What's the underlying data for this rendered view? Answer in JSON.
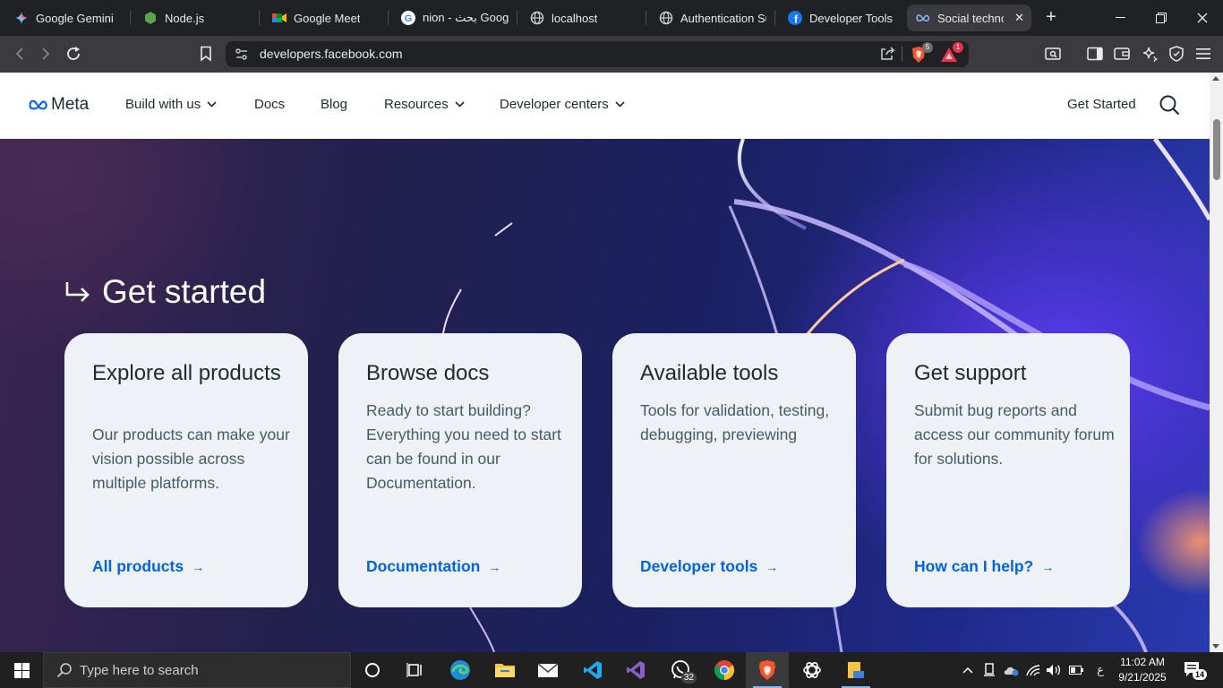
{
  "browser": {
    "tabs": [
      {
        "title": "Google Gemini",
        "icon": "gemini-icon"
      },
      {
        "title": "Node.js",
        "icon": "nodejs-icon"
      },
      {
        "title": "Google Meet",
        "icon": "google-meet-icon"
      },
      {
        "title": "nion - بحث Googl",
        "icon": "google-icon"
      },
      {
        "title": "localhost",
        "icon": "globe-icon"
      },
      {
        "title": "Authentication Su",
        "icon": "globe-icon"
      },
      {
        "title": "Developer Tools -",
        "icon": "facebook-icon"
      },
      {
        "title": "Social techno",
        "icon": "meta-icon",
        "active": true
      }
    ],
    "new_tab": "+",
    "url": "developers.facebook.com",
    "brave_shields_count": "5",
    "brave_rewards_count": "1"
  },
  "site": {
    "logo_text": "Meta",
    "nav": [
      {
        "label": "Build with us",
        "dropdown": true
      },
      {
        "label": "Docs",
        "dropdown": false
      },
      {
        "label": "Blog",
        "dropdown": false
      },
      {
        "label": "Resources",
        "dropdown": true
      },
      {
        "label": "Developer centers",
        "dropdown": true
      }
    ],
    "cta": "Get Started"
  },
  "hero": {
    "title": "Get started",
    "cards": [
      {
        "title": "Explore all products",
        "body": "Our products can make your vision possible across multiple platforms.",
        "link": "All products"
      },
      {
        "title": "Browse docs",
        "body": "Ready to start building? Everything you need to start can be found in our Documentation.",
        "link": "Documentation"
      },
      {
        "title": "Available tools",
        "body": "Tools for validation, testing, debugging, previewing",
        "link": "Developer tools"
      },
      {
        "title": "Get support",
        "body": "Submit bug reports and access our community forum for solutions.",
        "link": "How can I help?"
      }
    ]
  },
  "taskbar": {
    "search_placeholder": "Type here to search",
    "whatsapp_count": "32",
    "time": "11:02 AM",
    "date": "9/21/2025",
    "notifications": "14",
    "lang": "ع"
  },
  "colors": {
    "link": "#0064e0",
    "card_bg": "#eef1f5",
    "text_dark": "#1c2b33"
  }
}
